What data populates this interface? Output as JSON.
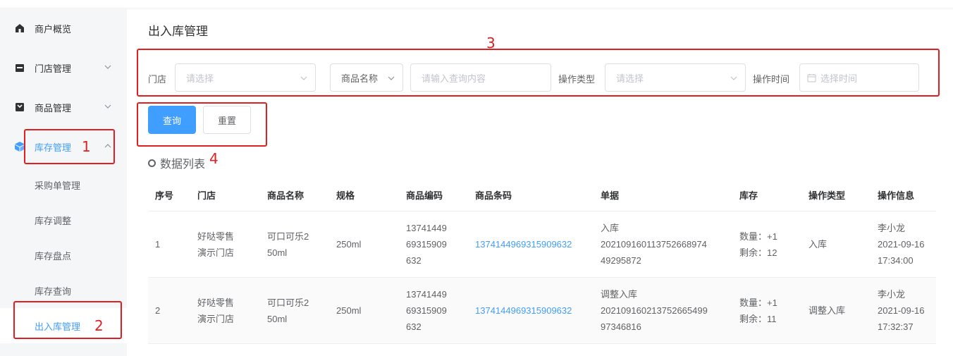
{
  "sidebar": {
    "items": [
      {
        "label": "商户概览",
        "icon": "home-icon"
      },
      {
        "label": "门店管理",
        "icon": "store-icon"
      },
      {
        "label": "商品管理",
        "icon": "goods-icon"
      },
      {
        "label": "库存管理",
        "icon": "cube-icon"
      }
    ],
    "sub_items": [
      {
        "label": "采购单管理"
      },
      {
        "label": "库存调整"
      },
      {
        "label": "库存盘点"
      },
      {
        "label": "库存查询"
      },
      {
        "label": "出入库管理"
      }
    ]
  },
  "page": {
    "title": "出入库管理"
  },
  "filters": {
    "store_label": "门店",
    "store_placeholder": "请选择",
    "product_field_select": "商品名称",
    "query_placeholder": "请输入查询内容",
    "op_type_label": "操作类型",
    "op_type_placeholder": "请选择",
    "op_time_label": "操作时间",
    "op_time_placeholder": "选择时间"
  },
  "buttons": {
    "query": "查询",
    "reset": "重置"
  },
  "list": {
    "title": "数据列表"
  },
  "table": {
    "headers": [
      "序号",
      "门店",
      "商品名称",
      "规格",
      "商品编码",
      "商品条码",
      "单据",
      "库存",
      "操作类型",
      "操作信息"
    ],
    "rows": [
      {
        "index": "1",
        "store": [
          "好哒零售",
          "演示门店"
        ],
        "name": [
          "可口可乐2",
          "50ml"
        ],
        "spec": "250ml",
        "code": [
          "13741449",
          "69315909",
          "632"
        ],
        "barcode": "1374144969315909632",
        "doc": [
          "入库",
          "20210916011375266897​4",
          "49295872"
        ],
        "stock": [
          "数量：+1",
          "剩余：12"
        ],
        "op_type": "入库",
        "op_info": [
          "李小龙",
          "2021-09-16",
          "17:34:00"
        ]
      },
      {
        "index": "2",
        "store": [
          "好哒零售",
          "演示门店"
        ],
        "name": [
          "可口可乐2",
          "50ml"
        ],
        "spec": "250ml",
        "code": [
          "13741449",
          "69315909",
          "632"
        ],
        "barcode": "1374144969315909632",
        "doc": [
          "调整入库",
          "20210916021375266549​9",
          "97346816"
        ],
        "stock": [
          "数量：+1",
          "剩余：11"
        ],
        "op_type": "调整入库",
        "op_info": [
          "李小龙",
          "2021-09-16",
          "17:32:37"
        ]
      }
    ]
  },
  "annotations": [
    "1",
    "2",
    "3",
    "4"
  ],
  "colors": {
    "accent": "#409eff",
    "annotation": "#e02020",
    "sidebar_bg": "#f5f6f8"
  }
}
